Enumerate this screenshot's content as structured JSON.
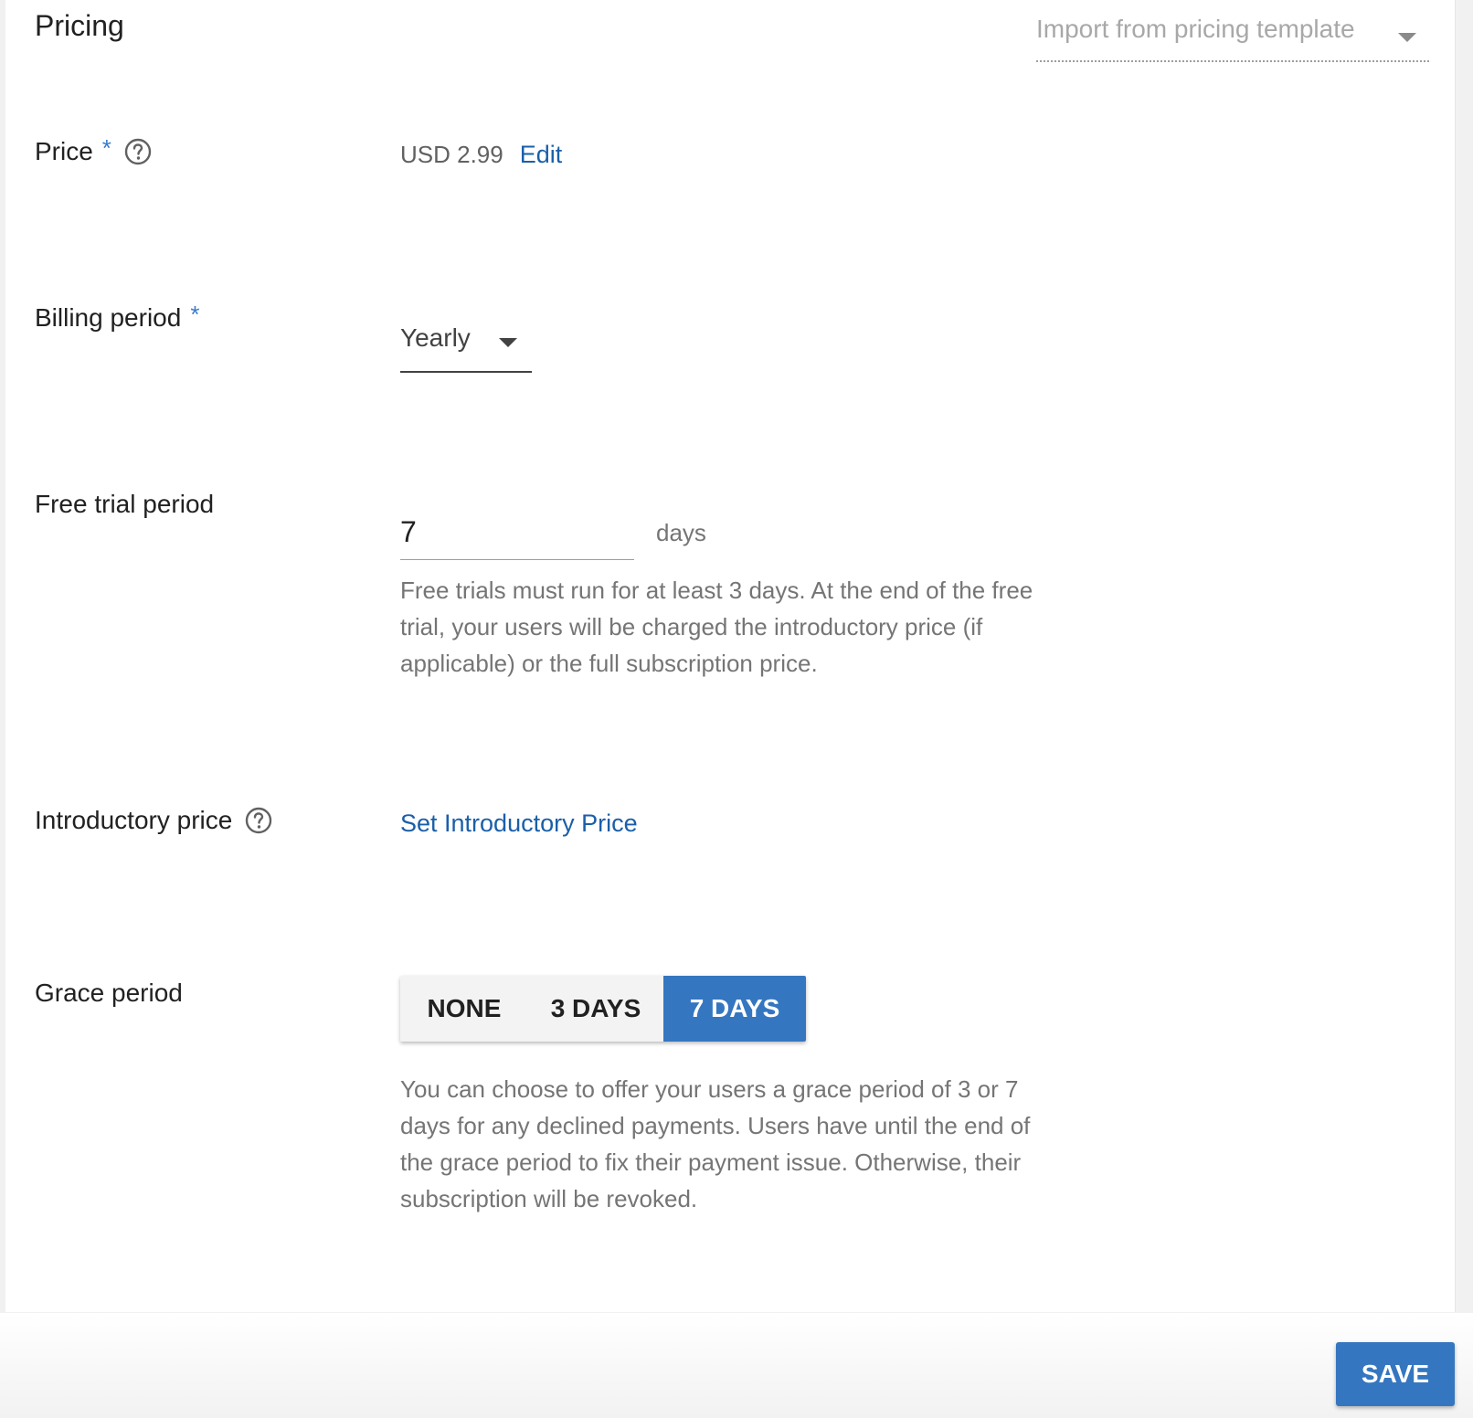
{
  "section": {
    "title": "Pricing",
    "template_select": {
      "placeholder": "Import from pricing template",
      "icon": "chevron-down-icon"
    }
  },
  "price": {
    "label": "Price",
    "required_mark": "*",
    "help_icon": "help-circle-icon",
    "value": "USD 2.99",
    "edit_label": "Edit"
  },
  "billing_period": {
    "label": "Billing period",
    "required_mark": "*",
    "selected": "Yearly",
    "icon": "chevron-down-icon"
  },
  "free_trial": {
    "label": "Free trial period",
    "value": "7",
    "suffix": "days",
    "helper": "Free trials must run for at least 3 days. At the end of the free trial, your users will be charged the introductory price (if applicable) or the full subscription price."
  },
  "introductory_price": {
    "label": "Introductory price",
    "help_icon": "help-circle-icon",
    "link_label": "Set Introductory Price"
  },
  "grace_period": {
    "label": "Grace period",
    "options": [
      "NONE",
      "3 DAYS",
      "7 DAYS"
    ],
    "selected": "7 DAYS",
    "helper": "You can choose to offer your users a grace period of 3 or 7 days for any declined payments. Users have until the end of the grace period to fix their payment issue. Otherwise, their subscription will be revoked."
  },
  "footer": {
    "save_label": "SAVE"
  },
  "colors": {
    "accent": "#3576c0",
    "link": "#1a5fa8",
    "text_primary": "#212121",
    "text_secondary": "#757575"
  }
}
